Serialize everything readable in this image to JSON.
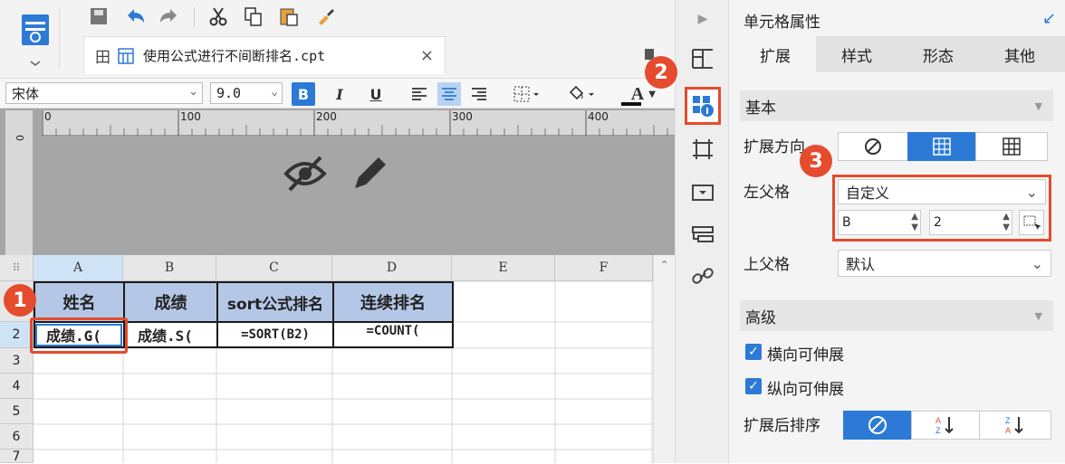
{
  "tab": {
    "icon_text": "田",
    "title": "使用公式进行不间断排名.cpt",
    "close": "×"
  },
  "format": {
    "font": "宋体",
    "size": "9.0",
    "bold": "B",
    "italic": "I",
    "underline": "U",
    "fontcolor": "A"
  },
  "ruler": {
    "ticks": [
      "0",
      "100",
      "200",
      "300",
      "400"
    ],
    "v_tick": "0"
  },
  "grid": {
    "corner": "⠿",
    "columns": [
      "A",
      "B",
      "C",
      "D",
      "E",
      "F"
    ],
    "rows": [
      "1",
      "2",
      "3",
      "4",
      "5",
      "6",
      "7"
    ],
    "header_cells": [
      "姓名",
      "成绩",
      "sort公式排名",
      "连续排名"
    ],
    "formula_cells": [
      "成绩.G(",
      "成绩.S(",
      "=SORT(B2)",
      "=COUNT("
    ]
  },
  "panel": {
    "title": "单元格属性",
    "tabs": [
      "扩展",
      "样式",
      "形态",
      "其他"
    ],
    "basic_label": "基本",
    "expand_dir_label": "扩展方向",
    "left_parent_label": "左父格",
    "left_parent_value": "自定义",
    "left_parent_col": "B",
    "left_parent_row": "2",
    "upper_parent_label": "上父格",
    "upper_parent_value": "默认",
    "advanced_label": "高级",
    "horiz_expand_label": "横向可伸展",
    "vert_expand_label": "纵向可伸展",
    "sort_label": "扩展后排序"
  },
  "badges": {
    "one": "1",
    "two": "2",
    "three": "3"
  },
  "colors": {
    "accent": "#2c7ad6",
    "badge": "#e54b2d",
    "header_fill": "#b4c7e7",
    "highlight_border": "#e54b2d"
  }
}
